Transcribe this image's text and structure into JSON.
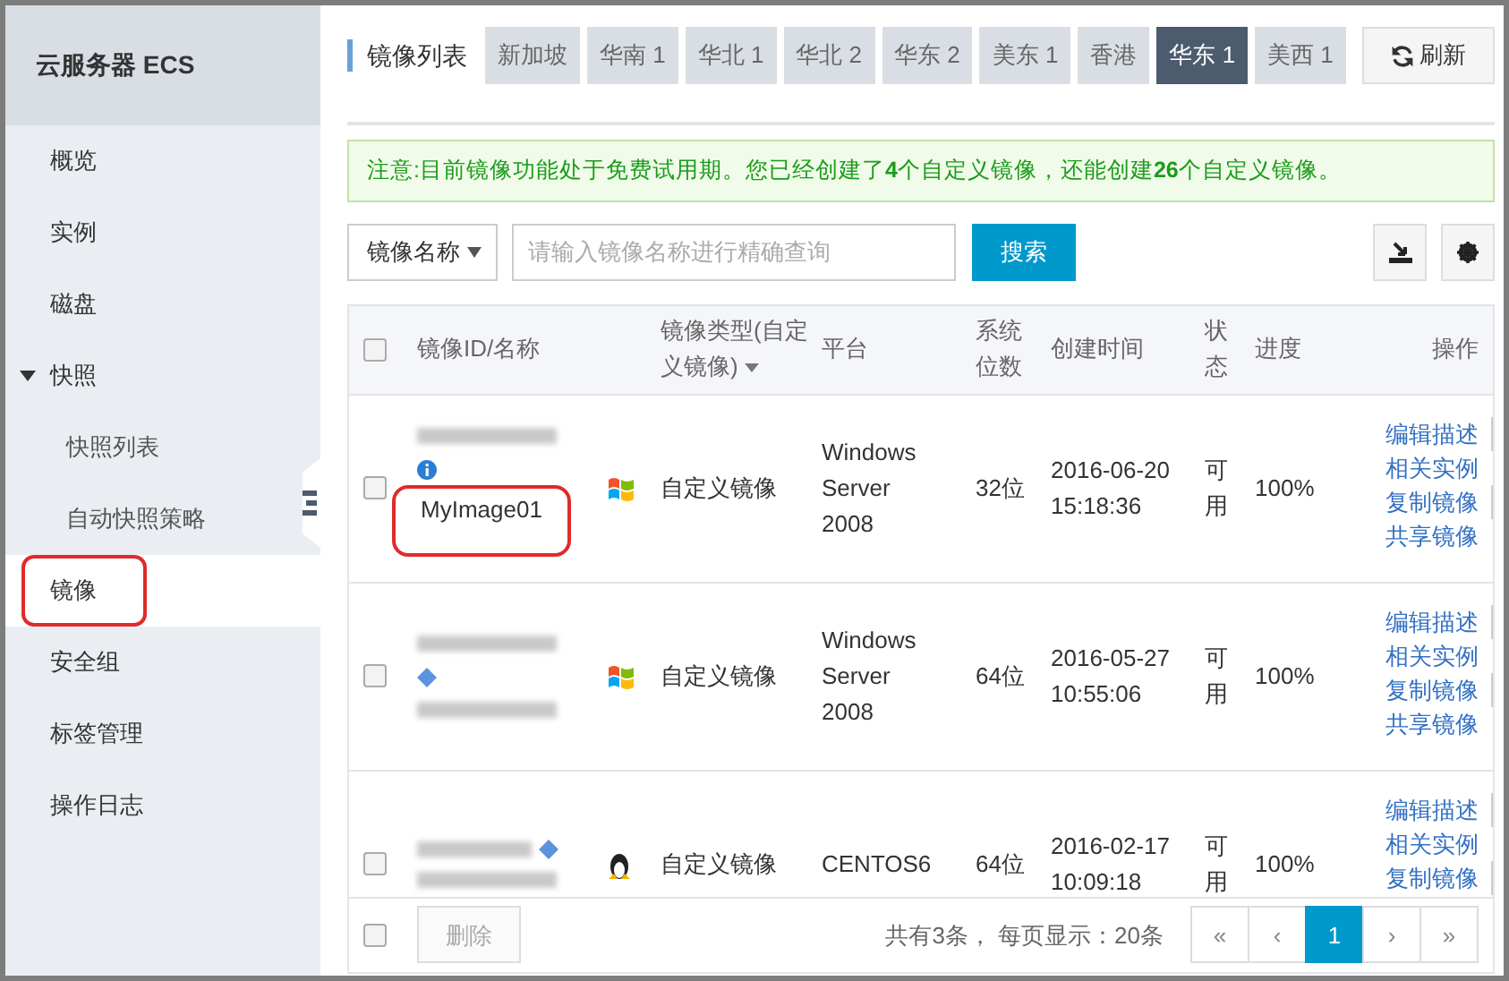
{
  "sidebar": {
    "title": "云服务器 ECS",
    "items": [
      {
        "label": "概览",
        "selected": false,
        "highlighted": false
      },
      {
        "label": "实例",
        "selected": false,
        "highlighted": false
      },
      {
        "label": "磁盘",
        "selected": false,
        "highlighted": false
      },
      {
        "label": "快照",
        "selected": false,
        "highlighted": false,
        "expanded": true,
        "children": [
          {
            "label": "快照列表",
            "selected": false,
            "highlighted": false
          },
          {
            "label": "自动快照策略",
            "selected": false,
            "highlighted": false
          }
        ]
      },
      {
        "label": "镜像",
        "selected": true,
        "highlighted": true
      },
      {
        "label": "安全组",
        "selected": false,
        "highlighted": false
      },
      {
        "label": "标签管理",
        "selected": false,
        "highlighted": false
      },
      {
        "label": "操作日志",
        "selected": false,
        "highlighted": false
      }
    ]
  },
  "header": {
    "title": "镜像列表",
    "regions": [
      {
        "label": "新加坡",
        "selected": false
      },
      {
        "label": "华南 1",
        "selected": false
      },
      {
        "label": "华北 1",
        "selected": false
      },
      {
        "label": "华北 2",
        "selected": false
      },
      {
        "label": "华东 2",
        "selected": false
      },
      {
        "label": "美东 1",
        "selected": false
      },
      {
        "label": "香港",
        "selected": false
      },
      {
        "label": "华东 1",
        "selected": true
      },
      {
        "label": "美西 1",
        "selected": false
      }
    ],
    "refresh": "刷新"
  },
  "notice": "注意:目前镜像功能处于免费试用期。您已经创建了**4**个自定义镜像，还能创建**26**个自定义镜像。",
  "search": {
    "field": "镜像名称",
    "placeholder": "请输入镜像名称进行精确查询",
    "button": "搜索"
  },
  "table": {
    "columns": [
      {
        "label": "镜像ID/名称",
        "dropdown": false
      },
      {
        "label": "镜像类型(自定义镜像)",
        "dropdown": true
      },
      {
        "label": "平台",
        "dropdown": false
      },
      {
        "label": "系统位数",
        "dropdown": false
      },
      {
        "label": "创建时间",
        "dropdown": false
      },
      {
        "label": "状态",
        "dropdown": false
      },
      {
        "label": "进度",
        "dropdown": false
      },
      {
        "label": "操作",
        "dropdown": false
      }
    ],
    "header_checked": false,
    "rows": [
      {
        "checked": false,
        "name": "MyImage01",
        "highlighted": true,
        "badge": {
          "kind": "info"
        },
        "os_icon": {
          "kind": "windows"
        },
        "type": "自定义镜像",
        "platform": "Windows Server 2008",
        "bits": "32位",
        "created": "2016-06-20 15:18:36",
        "status": "可用",
        "progress": "100%",
        "actions": [
          "编辑描述",
          "相关实例",
          "复制镜像",
          "共享镜像"
        ]
      },
      {
        "checked": false,
        "highlighted": false,
        "badge": {
          "kind": "tag"
        },
        "os_icon": {
          "kind": "windows"
        },
        "type": "自定义镜像",
        "platform": "Windows Server 2008",
        "bits": "64位",
        "created": "2016-05-27 10:55:06",
        "status": "可用",
        "progress": "100%",
        "actions": [
          "编辑描述",
          "相关实例",
          "复制镜像",
          "共享镜像"
        ]
      },
      {
        "checked": false,
        "highlighted": false,
        "badge": {
          "kind": "tag"
        },
        "os_icon": {
          "kind": "linux"
        },
        "type": "自定义镜像",
        "platform": "CENTOS6",
        "bits": "64位",
        "created": "2016-02-17 10:09:18",
        "status": "可用",
        "progress": "100%",
        "actions": [
          "编辑描述",
          "相关实例",
          "复制镜像"
        ]
      }
    ]
  },
  "footer": {
    "checked": false,
    "delete": {
      "label": "删除",
      "disabled": true
    },
    "summary": "共有3条， 每页显示：20条",
    "pages": [
      {
        "label": "«",
        "selected": false
      },
      {
        "label": "‹",
        "selected": false
      },
      {
        "label": "1",
        "selected": true
      },
      {
        "label": "›",
        "selected": false
      },
      {
        "label": "»",
        "selected": false
      }
    ]
  }
}
